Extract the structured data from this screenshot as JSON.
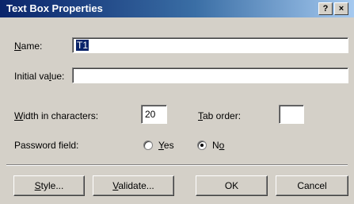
{
  "window": {
    "title": "Text Box Properties",
    "help_button": "?",
    "close_button": "×"
  },
  "form": {
    "name_label_key": "N",
    "name_label_rest": "ame:",
    "name_value": "T1",
    "initial_label_pre": "Initial va",
    "initial_label_key": "l",
    "initial_label_post": "ue:",
    "initial_value": "",
    "width_label_key": "W",
    "width_label_rest": "idth in characters:",
    "width_value": "20",
    "tab_label_key": "T",
    "tab_label_rest": "ab order:",
    "tab_value": "",
    "password_label": "Password field:",
    "yes_key": "Y",
    "yes_rest": "es",
    "no_pre": "N",
    "no_key": "o",
    "selected": "No"
  },
  "buttons": {
    "style_key": "S",
    "style_rest": "tyle...",
    "validate_key": "V",
    "validate_rest": "alidate...",
    "ok": "OK",
    "cancel": "Cancel"
  }
}
